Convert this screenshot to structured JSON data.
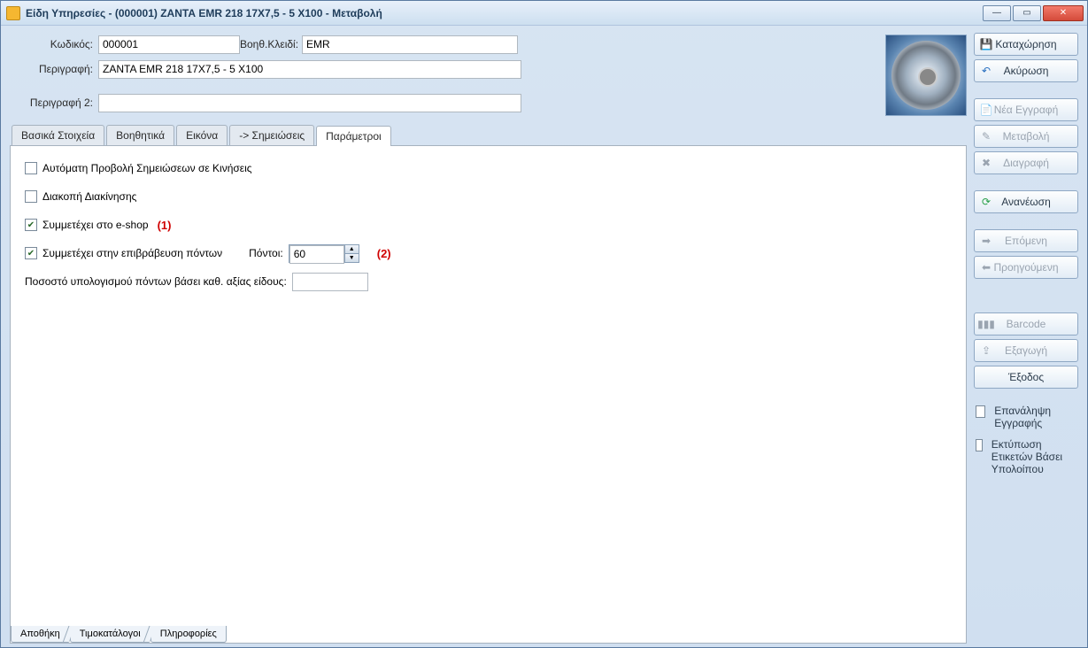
{
  "window": {
    "title": "Είδη Υπηρεσίες - (000001) ΖΑΝΤΑ EMR 218 17X7,5 - 5 X100 -  Μεταβολή"
  },
  "header": {
    "code_label": "Κωδικός:",
    "code_value": "000001",
    "auxkey_label": "Βοηθ.Κλειδί:",
    "auxkey_value": "EMR",
    "desc_label": "Περιγραφή:",
    "desc_value": "ZANTA EMR 218 17X7,5 - 5 X100",
    "desc2_label": "Περιγραφή 2:",
    "desc2_value": ""
  },
  "tabs": {
    "t0": "Βασικά Στοιχεία",
    "t1": "Βοηθητικά",
    "t2": "Εικόνα",
    "t3": "-> Σημειώσεις",
    "t4": "Παράμετροι"
  },
  "params": {
    "auto_notes": "Αυτόματη Προβολή Σημειώσεων σε Κινήσεις",
    "stop_move": "Διακοπή Διακίνησης",
    "eshop": "Συμμετέχει στο e-shop",
    "rewards": "Συμμετέχει στην επιβράβευση πόντων",
    "points_label": "Πόντοι:",
    "points_value": "60",
    "pct_label": "Ποσοστό υπολογισμού πόντων βάσει καθ. αξίας είδους:",
    "pct_value": "",
    "annot1": "(1)",
    "annot2": "(2)"
  },
  "side": {
    "register": "Καταχώρηση",
    "cancel": "Ακύρωση",
    "newrec": "Νέα Εγγραφή",
    "modify": "Μεταβολή",
    "delete": "Διαγραφή",
    "refresh": "Ανανέωση",
    "next": "Επόμενη",
    "prev": "Προηγούμενη",
    "barcode": "Barcode",
    "export": "Εξαγωγή",
    "exit": "Έξοδος",
    "repeat": "Επανάληψη Εγγραφής",
    "printlbl": "Εκτύπωση Ετικετών Βάσει Υπολοίπου"
  },
  "bottom_tabs": {
    "b0": "Αποθήκη",
    "b1": "Τιμοκατάλογοι",
    "b2": "Πληροφορίες"
  }
}
